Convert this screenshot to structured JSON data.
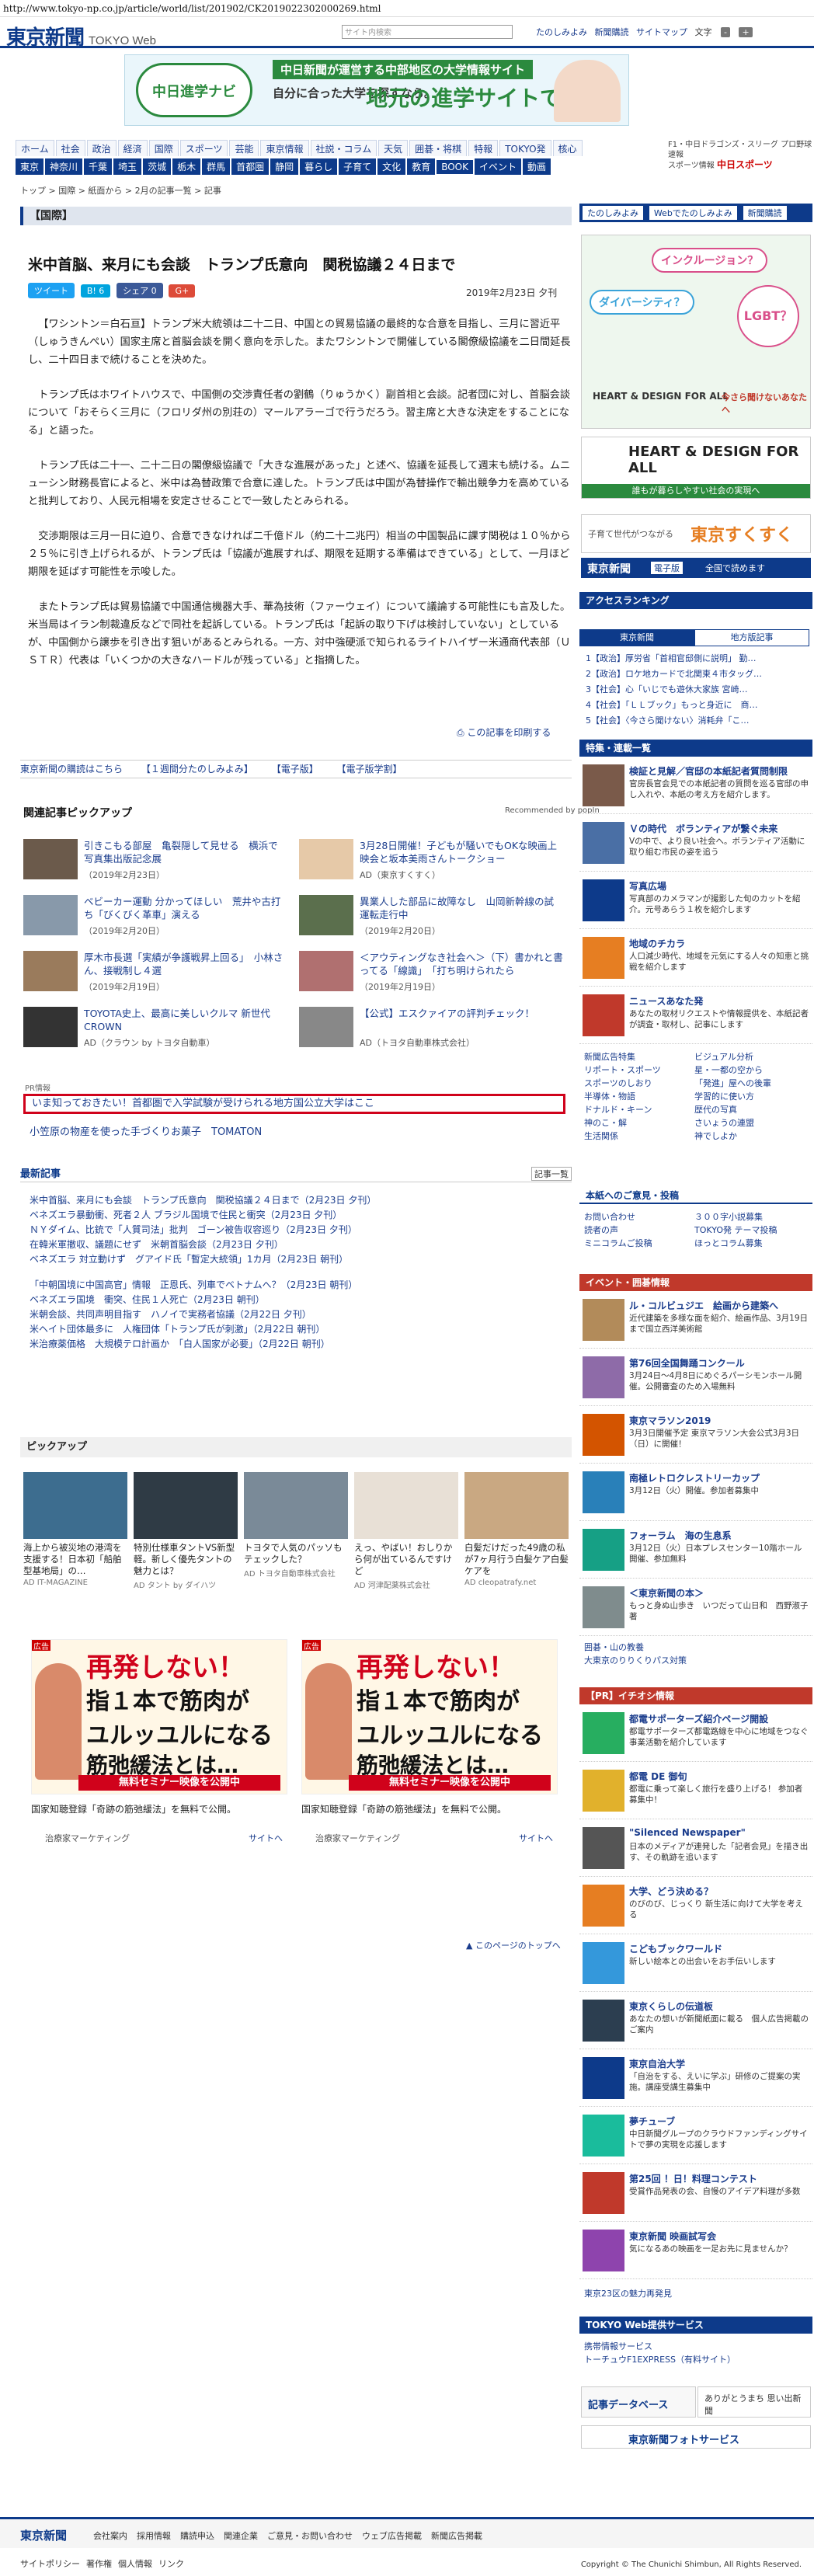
{
  "url": "http://www.tokyo-np.co.jp/article/world/list/201902/CK2019022302000269.html",
  "header": {
    "logo": "東京新聞",
    "logo_sub": "TOKYO Web",
    "search_placeholder": "サイト内検索",
    "links": [
      "たのしみよみ",
      "新聞購読",
      "サイトマップ",
      "文字"
    ],
    "font_small": "-",
    "font_large": "+"
  },
  "banner": {
    "logo": "中日進学ナビ",
    "line1": "中日新聞が運営する中部地区の大学情報サイト",
    "line2": "自分に合った大学を探すなら。",
    "line3": "地元の進学サイトで。"
  },
  "nav_primary": [
    "ホーム",
    "社会",
    "政治",
    "経済",
    "国際",
    "スポーツ",
    "芸能",
    "東京情報",
    "社説・コラム",
    "天気",
    "囲碁・将棋",
    "特報",
    "TOKYO発",
    "核心"
  ],
  "nav_secondary": [
    "東京",
    "神奈川",
    "千葉",
    "埼玉",
    "茨城",
    "栃木",
    "群馬",
    "首都圏",
    "静岡",
    "暮らし",
    "子育て",
    "文化",
    "教育",
    "BOOK",
    "イベント",
    "動画"
  ],
  "chuspo": {
    "line1": "F1・中日ドラゴンズ・スリーグ プロ野球速報",
    "line2": "スポーツ情報",
    "brand": "中日スポーツ"
  },
  "breadcrumb": "トップ > 国際 > 紙面から > 2月の記事一覧 > 記事",
  "section": "【国際】",
  "article": {
    "title": "米中首脳、来月にも会談　トランプ氏意向　関税協議２４日まで",
    "date": "2019年2月23日 夕刊",
    "social": {
      "tweet": "ツイート",
      "hatena": "B! 6",
      "share": "シェア 0",
      "gplus": "G+"
    },
    "paragraphs": [
      "【ワシントン＝白石亘】トランプ米大統領は二十二日、中国との貿易協議の最終的な合意を目指し、三月に習近平（しゅうきんぺい）国家主席と首脳会談を開く意向を示した。またワシントンで開催している閣僚級協議を二日間延長し、二十四日まで続けることを決めた。",
      "トランプ氏はホワイトハウスで、中国側の交渉責任者の劉鶴（りゅうかく）副首相と会談。記者団に対し、首脳会談について「おそらく三月に（フロリダ州の別荘の）マールアラーゴで行うだろう。習主席と大きな決定をすることになる」と語った。",
      "トランプ氏は二十一、二十二日の閣僚級協議で「大きな進展があった」と述べ、協議を延長して週末も続ける。ムニューシン財務長官によると、米中は為替政策で合意に達した。トランプ氏は中国が為替操作で輸出競争力を高めていると批判しており、人民元相場を安定させることで一致したとみられる。",
      "交渉期限は三月一日に迫り、合意できなければ二千億ドル（約二十二兆円）相当の中国製品に課す関税は１０％から２５％に引き上げられるが、トランプ氏は「協議が進展すれば、期限を延期する準備はできている」として、一月ほど期限を延ばす可能性を示唆した。",
      "またトランプ氏は貿易協議で中国通信機器大手、華為技術（ファーウェイ）について議論する可能性にも言及した。米当局はイラン制裁違反などで同社を起訴している。トランプ氏は「起訴の取り下げは検討していない」としているが、中国側から譲歩を引き出す狙いがあるとみられる。一方、対中強硬派で知られるライトハイザー米通商代表部（ＵＳＴＲ）代表は「いくつかの大きなハードルが残っている」と指摘した。"
    ],
    "print_label": "この記事を印刷する"
  },
  "related_bar": [
    "東京新聞の購読はこちら",
    "【１週間分たのしみよみ】",
    "【電子版】",
    "【電子版学割】"
  ],
  "pickup_related": {
    "heading": "関連記事ピックアップ",
    "recommended": "Recommended by popIn",
    "items": [
      {
        "title": "引きこもる部屋　亀裂隠して見せる　横浜で写真集出版記念展",
        "date": "（2019年2月23日）"
      },
      {
        "title": "3月28日開催！子どもが騒いでもOKな映画上映会と坂本美雨さんトークショー",
        "date": "AD（東京すくすく）"
      },
      {
        "title": "ベビーカー運動 分かってほしい　荒井や古打ち「びくびく革車」演える",
        "date": "（2019年2月20日）"
      },
      {
        "title": "異業人した部品に故障なし　山岡新幹線の試運転走行中",
        "date": "（2019年2月20日）"
      },
      {
        "title": "厚木市長選「実績が争護戦昇上回る」　小林さん、接戦制し４選",
        "date": "（2019年2月19日）"
      },
      {
        "title": "＜アウティングなき社会へ＞（下）書かれと書ってる「線識」　「打ち明けられたら",
        "date": "（2019年2月19日）"
      },
      {
        "title": "TOYOTA史上、最高に美しいクルマ 新世代CROWN",
        "date": "AD（クラウン by トヨタ自動車）"
      },
      {
        "title": "【公式】エスクァイアの評判チェック！",
        "date": "AD（トヨタ自動車株式会社）"
      }
    ]
  },
  "pr": {
    "label": "PR情報",
    "highlight": "いま知っておきたい！首都圏で入学試験が受けられる地方国公立大学はここ",
    "second": "小笠原の物産を使った手づくりお菓子　TOMATON"
  },
  "latest": {
    "heading": "最新記事",
    "more": "記事一覧",
    "items": [
      "米中首脳、来月にも会談　トランプ氏意向　関税協議２４日まで（2月23日 夕刊）",
      "ベネズエラ暴動衝、死者２人 ブラジル国境で住民と衝突（2月23日 夕刊）",
      "ＮＹダイム、比銃で「人質司法」批判　ゴーン被告収容巡り（2月23日 夕刊）",
      "在韓米軍撤収、議題にせず　米朝首脳会談（2月23日 夕刊）",
      "ベネズエラ 対立動けず　グアイド氏「暫定大統領」1カ月（2月23日 朝刊）",
      "「中朝国境に中国高官」情報　正恩氏、列車でベトナムへ？（2月23日 朝刊）",
      "ベネズエラ国境　衝突、住民１人死亡（2月23日 朝刊）",
      "米朝会談、共同声明目指す　ハノイで実務者協議（2月22日 夕刊）",
      "米ヘイト団体最多に　人権団体「トランプ氏が刺激」（2月22日 朝刊）",
      "米治療薬価格　大規模テロ計画か　「白人国家が必要」（2月22日 朝刊）"
    ]
  },
  "pickup": {
    "heading": "ピックアップ",
    "items": [
      {
        "text": "海上から被災地の港湾を支援する！日本初「船舶型基地局」の…",
        "ad": "AD IT-MAGAZINE"
      },
      {
        "text": "特別仕様車タントVS新型軽。新しく優先タントの魅力とは？",
        "ad": "AD タント by ダイハツ"
      },
      {
        "text": "トヨタで人気のパッソもテェックした？",
        "ad": "AD トヨタ自動車株式会社"
      },
      {
        "text": "えっ、やばい！おしりから何が出ているんですけど",
        "ad": "AD 河津配薬株式会社"
      },
      {
        "text": "白髪だけだった49歳の私が7ヶ月行う白髪ケア白髪ケアを",
        "ad": "AD cleopatrafy.net"
      }
    ]
  },
  "ads": [
    {
      "tag": "広告",
      "line1": "再発しない！",
      "line2": "指１本で筋肉が",
      "line3": "ユルッユルになる",
      "line4": "筋弛緩法とは…",
      "cta": "無料セミナー映像を公開中",
      "caption": "国家知聴登録「奇跡の筋弛緩法」を無料で公開。",
      "source": "治療家マーケティング",
      "site": "サイトへ"
    },
    {
      "tag": "広告",
      "line1": "再発しない！",
      "line2": "指１本で筋肉が",
      "line3": "ユルッユルになる",
      "line4": "筋弛緩法とは…",
      "cta": "無料セミナー映像を公開中",
      "caption": "国家知聴登録「奇跡の筋弛緩法」を無料で公開。",
      "source": "治療家マーケティング",
      "site": "サイトへ"
    }
  ],
  "page_top": "このページのトップへ",
  "sidebar": {
    "buttons": [
      "たのしみよみ",
      "Webでたのしみよみ",
      "新聞購読"
    ],
    "promo1": {
      "bubble1": "インクルージョン？",
      "bubble2": "ダイバーシティ？",
      "bubble3": "LGBT？",
      "hd": "HEART & DESIGN FOR ALL",
      "cta": "今さら聞けないあなたへ"
    },
    "promo2": {
      "title": "HEART & DESIGN FOR ALL",
      "sub": "誰もが暮らしやすい社会の実現へ"
    },
    "sukusuku": {
      "text": "子育て世代がつながる",
      "brand": "東京すくすく"
    },
    "denshi": {
      "brand": "東京新聞",
      "tag": "電子版",
      "cta": "全国で読めます"
    },
    "ranking": {
      "heading": "アクセスランキング",
      "tabs": [
        "東京新聞",
        "地方版記事"
      ],
      "items": [
        "1【政治】厚労省「首相官邸側に説明」 勤…",
        "2【政治】ロケ地カードで北関東４市タッグ…",
        "3【社会】心「いじでも遊休大家族 宮崎…",
        "4【社会】「ＬＬブック」もっと身近に　商…",
        "5【社会】〈今さら聞けない〉消耗弁「こ…"
      ]
    },
    "tokuhou": {
      "heading": "特集・連載一覧",
      "items": [
        {
          "title": "検証と見解／官邸の本紙記者質問制限",
          "desc": "官房長官会見での本紙記者の質問を巡る官邸の申し入れや、本紙の考え方を紹介します。"
        },
        {
          "title": "Ｖの時代　ボランティアが繋ぐ未来",
          "desc": "Vの中で、より良い社会へ。ボランティア活動に取り組む市民の姿を追う"
        },
        {
          "title": "写真広場",
          "desc": "写真部のカメラマンが撮影した旬のカットを紹介。元号あらう１枚を紹介します"
        },
        {
          "title": "地域のチカラ",
          "desc": "人口減少時代、地域を元気にする人々の知恵と挑戦を紹介します"
        },
        {
          "title": "ニュースあなた発",
          "desc": "あなたの取材リクエストや情報提供を、本紙記者が調査・取材し、記事にします"
        }
      ],
      "links": [
        "新聞広告特集",
        "ビジュアル分析",
        "リポート・スポーツ",
        "星・一都の空から",
        "スポーツのしおり",
        "「発進」屋への後輩",
        "半導体・物語",
        "学習的に使い方",
        "ドナルド・キーン",
        "歴代の写真",
        "神のこ・解",
        "さいょうの連盟",
        "生活関係",
        "神でしよか"
      ]
    },
    "info": {
      "heading": "本紙へのご意見・投稿",
      "links": [
        "お問い合わせ",
        "３００字小説募集",
        "読者の声",
        "TOKYO発 テーマ投稿",
        "ミニコラムご投稿",
        "ほっとコラム募集"
      ]
    },
    "events": {
      "heading": "イベント・囲碁情報",
      "items": [
        {
          "title": "ル・コルビュジエ　絵画から建築へ",
          "desc": "近代建築を多様な面を紹介、絵画作品、3月19日まで国立西洋美術館"
        },
        {
          "title": "第76回全国舞踊コンクール",
          "desc": "3月24日〜4月8日にめぐろパーシモンホール開催。公開審査のため入場無料"
        },
        {
          "title": "東京マラソン2019",
          "desc": "3月3日開催予定 東京マラソン大会公式3月3日（日）に開催！"
        },
        {
          "title": "南極レトロクレストリーカップ",
          "desc": "3月12日（火）開催。参加者募集中"
        },
        {
          "title": "フォーラム　海の生息系",
          "desc": "3月12日（火）日本プレスセンター10階ホール開催、参加無料"
        },
        {
          "title": "＜東京新聞の本＞",
          "desc": "もっと身ぬ山歩き　いつだって山日和　西野淑子 著"
        }
      ],
      "links": [
        "囲碁・山の教養",
        "大東京のりりくりパス対策"
      ]
    },
    "pr": {
      "heading": "【PR】イチオシ情報",
      "items": [
        {
          "title": "都電サポーターズ紹介ページ開設",
          "desc": "都電サポーターズ都電路線を中心に地域をつなぐ事業活動を紹介しています"
        },
        {
          "title": "都電 DE 御旬",
          "desc": "都電に乗って楽しく旅行を盛り上げる！ 参加者募集中！"
        },
        {
          "title": "\"Silenced Newspaper\"",
          "desc": "日本のメディアが連発した「記者会見」を描き出す、その軌跡を追います"
        },
        {
          "title": "大学、どう決める？",
          "desc": "のびのび、じっくり 新生活に向けて大学を考える"
        },
        {
          "title": "こどもブックワールド",
          "desc": "新しい絵本との出会いをお手伝いします"
        },
        {
          "title": "東京くらしの伝道板",
          "desc": "あなたの想いが新聞紙面に載る　個人広告掲載のご案内"
        },
        {
          "title": "東京自治大学",
          "desc": "「自治をする、えいに学ぶ」研修のご提案の実施。講座受講生募集中"
        },
        {
          "title": "夢チューブ",
          "desc": "中日新聞グループのクラウドファンディングサイトで夢の実現を応援します"
        },
        {
          "title": "第25回 ！日！料理コンテスト",
          "desc": "受賞作品発表の会、自慢のアイデア料理が多数"
        },
        {
          "title": "東京新聞 映画試写会",
          "desc": "気になるあの映画を一足お先に見ませんか？"
        }
      ],
      "more": "東京23区の魅力再発見"
    },
    "web": {
      "heading": "TOKYO Web提供サービス",
      "links": [
        "携帯情報サービス",
        "トーチュウF1EXPRESS（有料サイト）"
      ]
    },
    "bottom": {
      "db": "記事データベース",
      "dokushu": "ありがとうまち 思い出新聞",
      "denshi": "東京新聞フォトサービス"
    }
  },
  "footer": {
    "logo": "東京新聞",
    "links": [
      "会社案内",
      "採用情報",
      "購読申込",
      "関連企業",
      "ご意見・お問い合わせ",
      "ウェブ広告掲載",
      "新聞広告掲載"
    ],
    "links2": [
      "サイトポリシー",
      "著作権",
      "個人情報",
      "リンク"
    ],
    "copyright": "Copyright © The Chunichi Shimbun, All Rights Reserved."
  }
}
